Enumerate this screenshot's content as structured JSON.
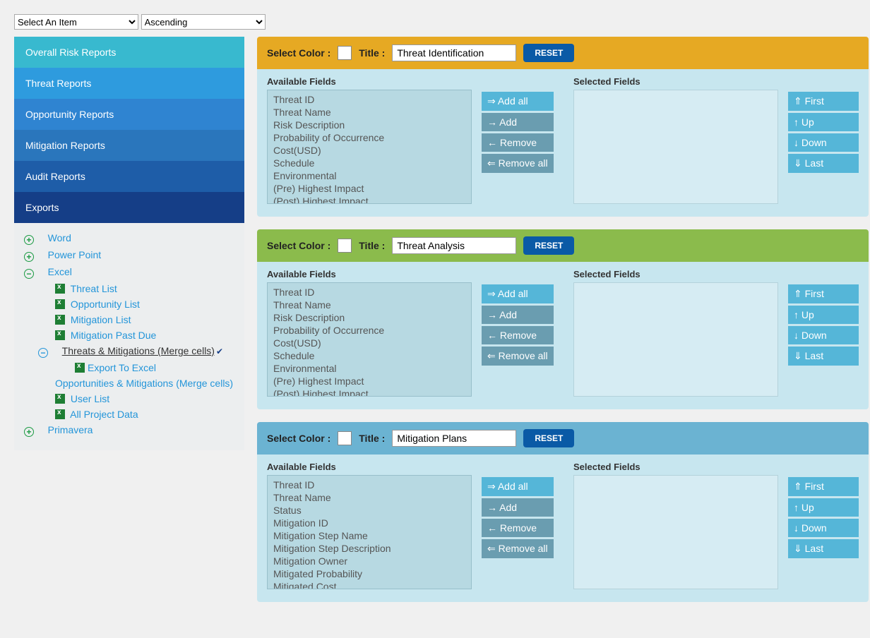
{
  "top_selects": {
    "item": "Select An Item",
    "order": "Ascending"
  },
  "sidebar_nav": {
    "overall": "Overall Risk Reports",
    "threat": "Threat Reports",
    "opportunity": "Opportunity Reports",
    "mitigation": "Mitigation Reports",
    "audit": "Audit Reports",
    "exports": "Exports"
  },
  "tree": {
    "word": "Word",
    "powerpoint": "Power Point",
    "excel": "Excel",
    "threat_list": "Threat List",
    "opportunity_list": "Opportunity List",
    "mitigation_list": "Mitigation List",
    "mitigation_past_due": "Mitigation Past Due",
    "threats_mitigations": "Threats & Mitigations (Merge cells)",
    "export_to_excel": "Export To Excel",
    "opportunities_mitigations": "Opportunities & Mitigations (Merge cells)",
    "user_list": "User List",
    "all_project_data": "All Project Data",
    "primavera": "Primavera"
  },
  "labels": {
    "select_color": "Select Color :",
    "title": "Title :",
    "reset": "RESET",
    "available": "Available Fields",
    "selected": "Selected Fields",
    "add_all": "⇒ Add all",
    "add": "→ Add",
    "remove": "← Remove",
    "remove_all": "⇐ Remove all",
    "first": "⇑ First",
    "up": "↑ Up",
    "down": "↓ Down",
    "last": "⇓ Last"
  },
  "panels": [
    {
      "title": "Threat Identification",
      "header_class": "hdr-orange",
      "fields": [
        "Threat ID",
        "Threat Name",
        "Risk Description",
        "Probability of Occurrence",
        "Cost(USD)",
        "Schedule",
        "Environmental",
        "(Pre) Highest Impact",
        "(Post) Highest Impact"
      ]
    },
    {
      "title": "Threat Analysis",
      "header_class": "hdr-green",
      "fields": [
        "Threat ID",
        "Threat Name",
        "Risk Description",
        "Probability of Occurrence",
        "Cost(USD)",
        "Schedule",
        "Environmental",
        "(Pre) Highest Impact",
        "(Post) Highest Impact"
      ]
    },
    {
      "title": "Mitigation Plans",
      "header_class": "hdr-blue",
      "fields": [
        "Threat ID",
        "Threat Name",
        "Status",
        "Mitigation ID",
        "Mitigation Step Name",
        "Mitigation Step Description",
        "Mitigation Owner",
        "Mitigated Probability",
        "Mitigated Cost"
      ]
    }
  ]
}
